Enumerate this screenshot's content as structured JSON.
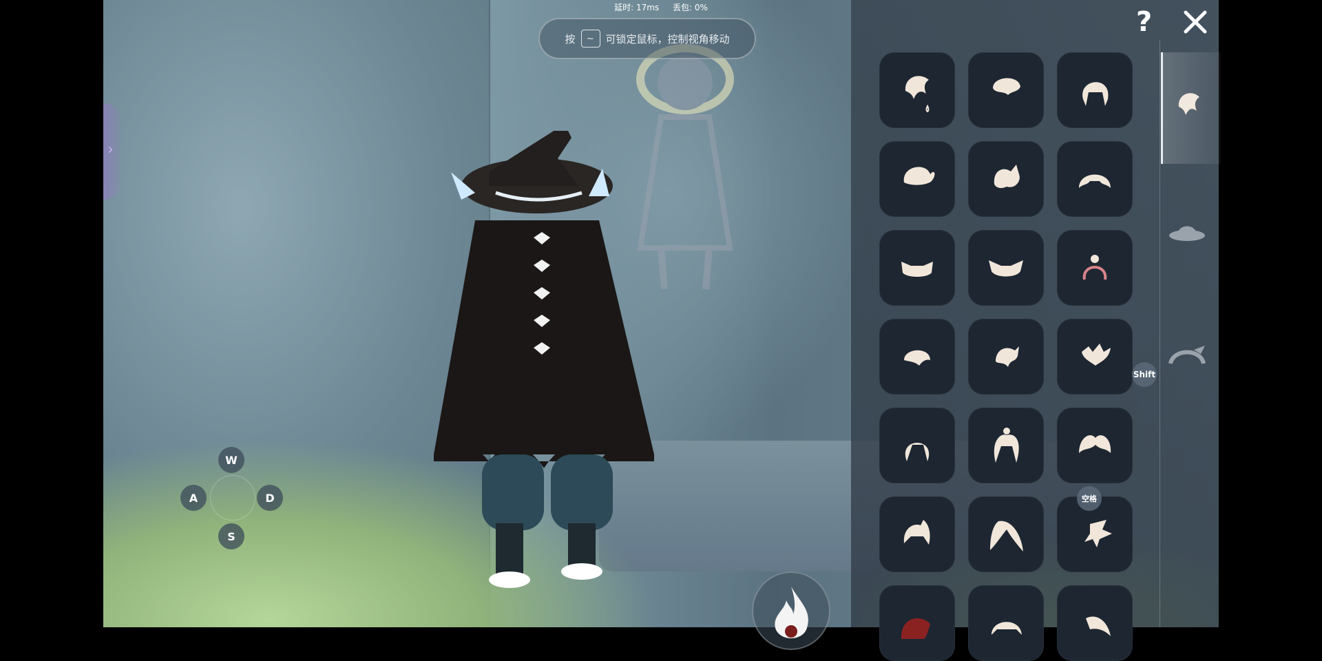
{
  "hud": {
    "latency_label": "延时: 17ms",
    "packet_loss_label": "丢包: 0%",
    "hint_prefix": "按",
    "hint_key": "~",
    "hint_suffix": "可锁定鼠标，控制视角移动"
  },
  "controls": {
    "w": "W",
    "a": "A",
    "s": "S",
    "d": "D",
    "shift": "Shift",
    "space": "空格"
  },
  "panel": {
    "help": "?",
    "categories": [
      "hair-icon",
      "hat-icon",
      "hair-accessory-icon"
    ],
    "selected_category": "hair-icon",
    "hair_items_visible": 21
  }
}
